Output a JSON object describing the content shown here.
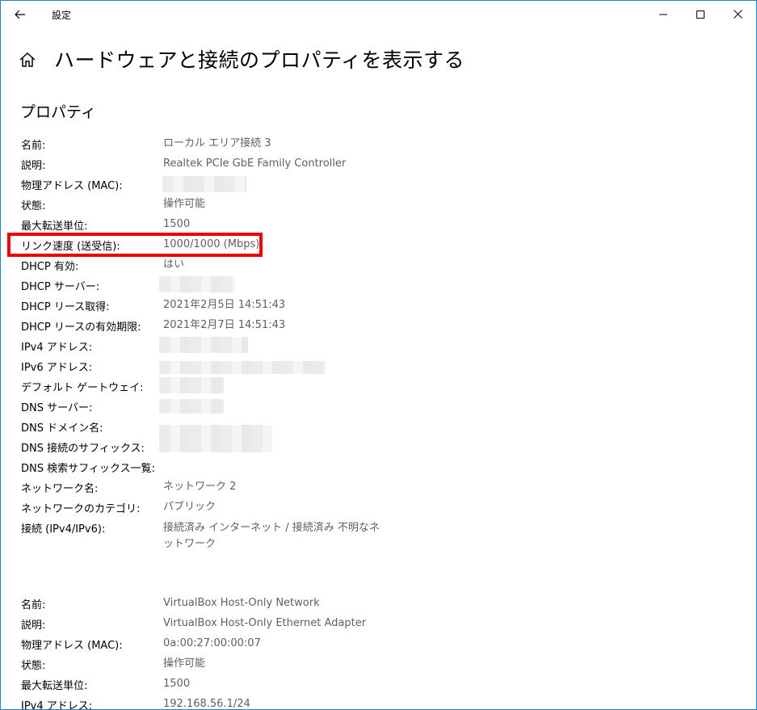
{
  "window": {
    "title": "設定"
  },
  "page": {
    "title": "ハードウェアと接続のプロパティを表示する",
    "section_title": "プロパティ"
  },
  "adapter1": [
    {
      "label": "名前:",
      "value": "ローカル エリア接続 3"
    },
    {
      "label": "説明:",
      "value": "Realtek PCIe GbE Family Controller"
    },
    {
      "label": "物理アドレス (MAC):",
      "value": ""
    },
    {
      "label": "状態:",
      "value": "操作可能"
    },
    {
      "label": "最大転送単位:",
      "value": "1500"
    },
    {
      "label": "リンク速度 (送受信):",
      "value": "1000/1000 (Mbps)"
    },
    {
      "label": "DHCP 有効:",
      "value": "はい"
    },
    {
      "label": "DHCP サーバー:",
      "value": ""
    },
    {
      "label": "DHCP リース取得:",
      "value": "2021年2月5日 14:51:43"
    },
    {
      "label": "DHCP リースの有効期限:",
      "value": "2021年2月7日 14:51:43"
    },
    {
      "label": "IPv4 アドレス:",
      "value": ""
    },
    {
      "label": "IPv6 アドレス:",
      "value": ""
    },
    {
      "label": "デフォルト ゲートウェイ:",
      "value": ""
    },
    {
      "label": "DNS サーバー:",
      "value": ""
    },
    {
      "label": "DNS ドメイン名:",
      "value": ""
    },
    {
      "label": "DNS 接続のサフィックス:",
      "value": ""
    },
    {
      "label": "DNS 検索サフィックス一覧:",
      "value": ""
    },
    {
      "label": "ネットワーク名:",
      "value": "ネットワーク 2"
    },
    {
      "label": "ネットワークのカテゴリ:",
      "value": "パブリック"
    },
    {
      "label": "接続 (IPv4/IPv6):",
      "value": "接続済み インターネット / 接続済み 不明なネットワーク"
    }
  ],
  "adapter2": [
    {
      "label": "名前:",
      "value": "VirtualBox Host-Only Network"
    },
    {
      "label": "説明:",
      "value": "VirtualBox Host-Only Ethernet Adapter"
    },
    {
      "label": "物理アドレス (MAC):",
      "value": "0a:00:27:00:00:07"
    },
    {
      "label": "状態:",
      "value": "操作可能"
    },
    {
      "label": "最大転送単位:",
      "value": "1500"
    },
    {
      "label": "IPv4 アドレス:",
      "value": "192.168.56.1/24"
    }
  ],
  "colors": {
    "window_border": "#1883d7",
    "highlight": "#e8000b",
    "value_text": "#5f5f5f"
  }
}
